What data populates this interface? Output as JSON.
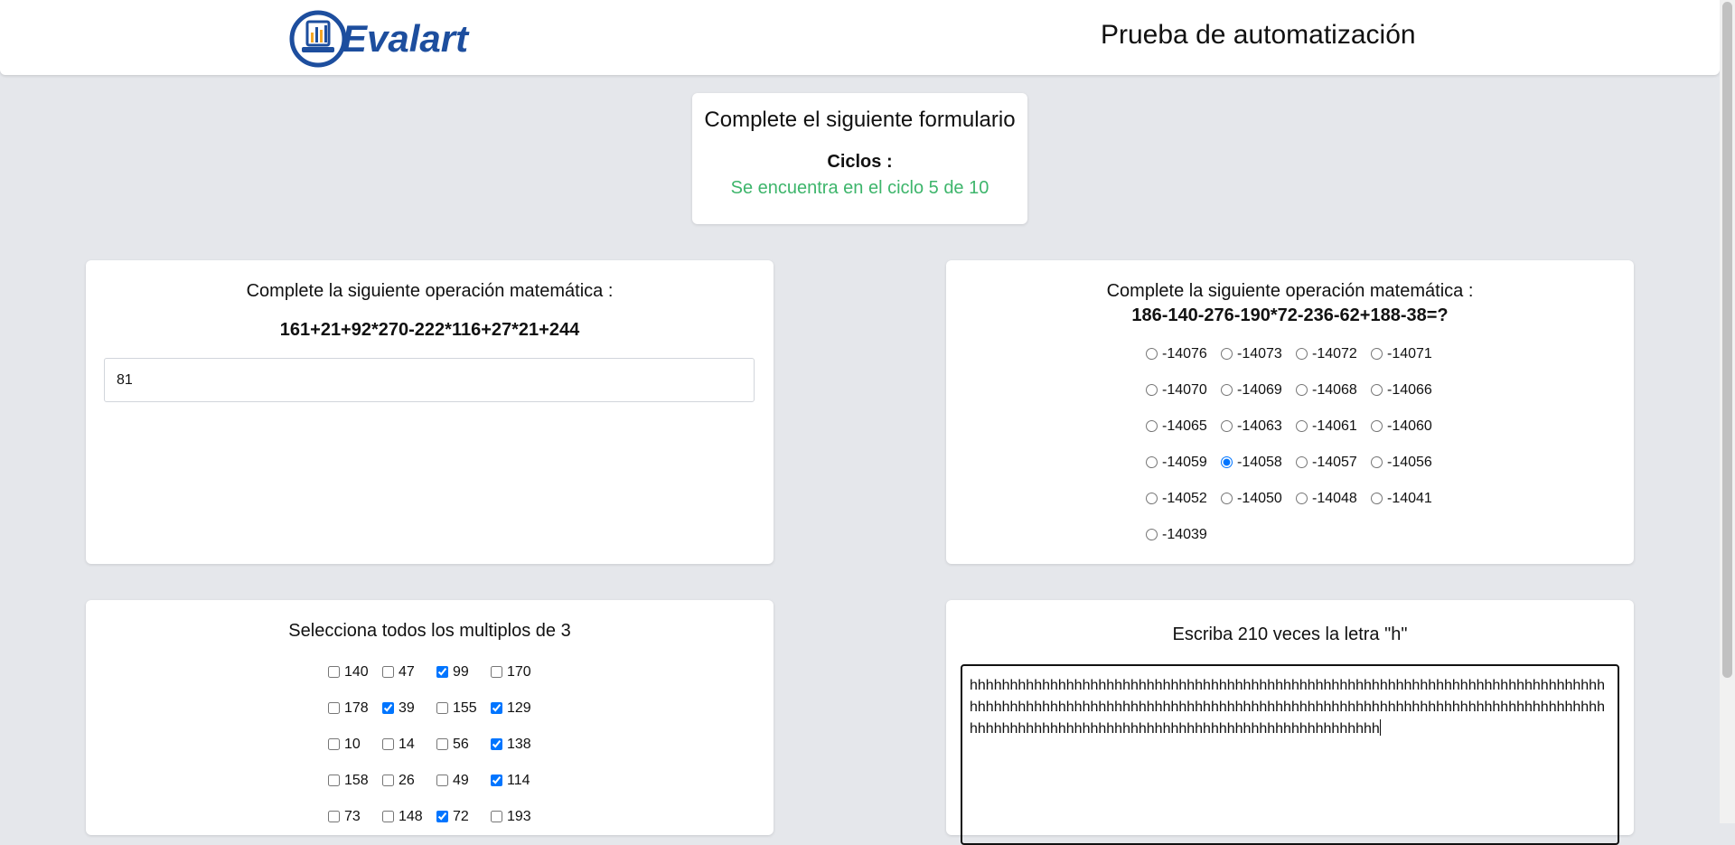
{
  "header": {
    "logo_text": "Evalart",
    "title": "Prueba de automatización",
    "brand_color": "#1d4e9e"
  },
  "form_info": {
    "title": "Complete el siguiente formulario",
    "cycles_label": "Ciclos :",
    "cycles_status": "Se encuentra en el ciclo 5 de 10"
  },
  "math_input": {
    "label": "Complete la siguiente operación matemática :",
    "expression": "161+21+92*270-222*116+27*21+244",
    "value": "81"
  },
  "math_radio": {
    "label": "Complete la siguiente operación matemática :",
    "expression": "186-140-276-190*72-236-62+188-38=?",
    "selected": "-14058",
    "options": [
      "-14076",
      "-14073",
      "-14072",
      "-14071",
      "-14070",
      "-14069",
      "-14068",
      "-14066",
      "-14065",
      "-14063",
      "-14061",
      "-14060",
      "-14059",
      "-14058",
      "-14057",
      "-14056",
      "-14052",
      "-14050",
      "-14048",
      "-14041",
      "-14039"
    ]
  },
  "multiples": {
    "label": "Selecciona todos los multiplos de 3",
    "options": [
      {
        "label": "140",
        "checked": false
      },
      {
        "label": "47",
        "checked": false
      },
      {
        "label": "99",
        "checked": true
      },
      {
        "label": "170",
        "checked": false
      },
      {
        "label": "178",
        "checked": false
      },
      {
        "label": "39",
        "checked": true
      },
      {
        "label": "155",
        "checked": false
      },
      {
        "label": "129",
        "checked": true
      },
      {
        "label": "10",
        "checked": false
      },
      {
        "label": "14",
        "checked": false
      },
      {
        "label": "56",
        "checked": false
      },
      {
        "label": "138",
        "checked": true
      },
      {
        "label": "158",
        "checked": false
      },
      {
        "label": "26",
        "checked": false
      },
      {
        "label": "49",
        "checked": false
      },
      {
        "label": "114",
        "checked": true
      },
      {
        "label": "73",
        "checked": false
      },
      {
        "label": "148",
        "checked": false
      },
      {
        "label": "72",
        "checked": true
      },
      {
        "label": "193",
        "checked": false
      }
    ]
  },
  "letters": {
    "label": "Escriba 210 veces la letra \"h\"",
    "value": "hhhhhhhhhhhhhhhhhhhhhhhhhhhhhhhhhhhhhhhhhhhhhhhhhhhhhhhhhhhhhhhhhhhhhhhhhhhhhhhhhhhhhhhhhhhhhhhhhhhhhhhhhhhhhhhhhhhhhhhhhhhhhhhhhhhhhhhhhhhhhhhhhhhhhhhhhhhhhhhhhhhhhhhhhhhhhhhhhhhhhhhhhhhhhhhhhhhhhhhhhhhhhhhhh"
  }
}
